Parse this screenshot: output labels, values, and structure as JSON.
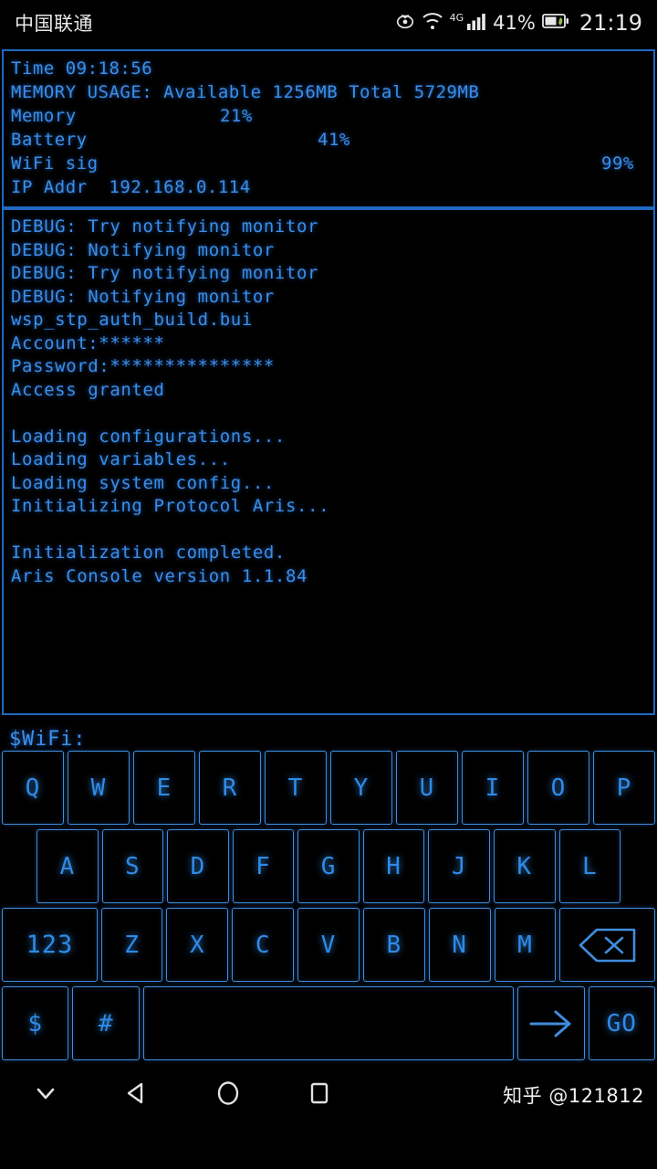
{
  "statusbar": {
    "carrier": "中国联通",
    "network": "4G",
    "battery_percent": "41%",
    "clock": "21:19",
    "icons": [
      "eye-care-icon",
      "wifi-icon",
      "signal-bars-icon",
      "battery-icon"
    ]
  },
  "stats": {
    "time_line": "Time 09:18:56",
    "memory_line": "MEMORY USAGE: Available 1256MB Total 5729MB",
    "meters": [
      {
        "label": "Memory",
        "value": "21%",
        "percent": 21
      },
      {
        "label": "Battery",
        "value": "41%",
        "percent": 41
      },
      {
        "label": "WiFi sig",
        "value": "99%",
        "percent": 99
      }
    ],
    "ip_line": "IP Addr  192.168.0.114"
  },
  "console": {
    "lines": [
      "DEBUG: Try notifying monitor",
      "DEBUG: Notifying monitor",
      "DEBUG: Try notifying monitor",
      "DEBUG: Notifying monitor",
      "wsp_stp_auth_build.bui",
      "Account:******",
      "Password:***************",
      "Access granted",
      "",
      "Loading configurations...",
      "Loading variables...",
      "Loading system config...",
      "Initializing Protocol Aris...",
      "",
      "Initialization completed.",
      "Aris Console version 1.1.84"
    ]
  },
  "input": {
    "prompt": "$WiFi:",
    "value": ""
  },
  "keyboard": {
    "rows": [
      [
        {
          "label": "Q",
          "name": "key-q"
        },
        {
          "label": "W",
          "name": "key-w"
        },
        {
          "label": "E",
          "name": "key-e"
        },
        {
          "label": "R",
          "name": "key-r"
        },
        {
          "label": "T",
          "name": "key-t"
        },
        {
          "label": "Y",
          "name": "key-y"
        },
        {
          "label": "U",
          "name": "key-u"
        },
        {
          "label": "I",
          "name": "key-i"
        },
        {
          "label": "O",
          "name": "key-o"
        },
        {
          "label": "P",
          "name": "key-p"
        }
      ],
      [
        {
          "label": "A",
          "name": "key-a"
        },
        {
          "label": "S",
          "name": "key-s"
        },
        {
          "label": "D",
          "name": "key-d"
        },
        {
          "label": "F",
          "name": "key-f"
        },
        {
          "label": "G",
          "name": "key-g"
        },
        {
          "label": "H",
          "name": "key-h"
        },
        {
          "label": "J",
          "name": "key-j"
        },
        {
          "label": "K",
          "name": "key-k"
        },
        {
          "label": "L",
          "name": "key-l"
        }
      ],
      [
        {
          "label": "123",
          "name": "key-numeric-mode"
        },
        {
          "label": "Z",
          "name": "key-z"
        },
        {
          "label": "X",
          "name": "key-x"
        },
        {
          "label": "C",
          "name": "key-c"
        },
        {
          "label": "V",
          "name": "key-v"
        },
        {
          "label": "B",
          "name": "key-b"
        },
        {
          "label": "N",
          "name": "key-n"
        },
        {
          "label": "M",
          "name": "key-m"
        },
        {
          "label": "",
          "name": "key-backspace",
          "icon": "backspace-icon"
        }
      ],
      [
        {
          "label": "$",
          "name": "key-dollar"
        },
        {
          "label": "#",
          "name": "key-hash"
        },
        {
          "label": "",
          "name": "key-space"
        },
        {
          "label": "",
          "name": "key-arrow-right",
          "icon": "arrow-right-icon"
        },
        {
          "label": "GO",
          "name": "key-go"
        }
      ]
    ]
  },
  "navbar": {
    "buttons": [
      {
        "name": "hide-keyboard-button",
        "icon": "chevron-down-icon"
      },
      {
        "name": "back-button",
        "icon": "triangle-left-icon"
      },
      {
        "name": "home-button",
        "icon": "circle-icon"
      },
      {
        "name": "recents-button",
        "icon": "square-icon"
      }
    ],
    "watermark": "知乎 @121812"
  },
  "colors": {
    "accent": "#3b8ee8",
    "bar_fill": "#2a7fd4",
    "border": "#1d69c4",
    "key_border": "#3f8ddd",
    "background": "#000000"
  }
}
